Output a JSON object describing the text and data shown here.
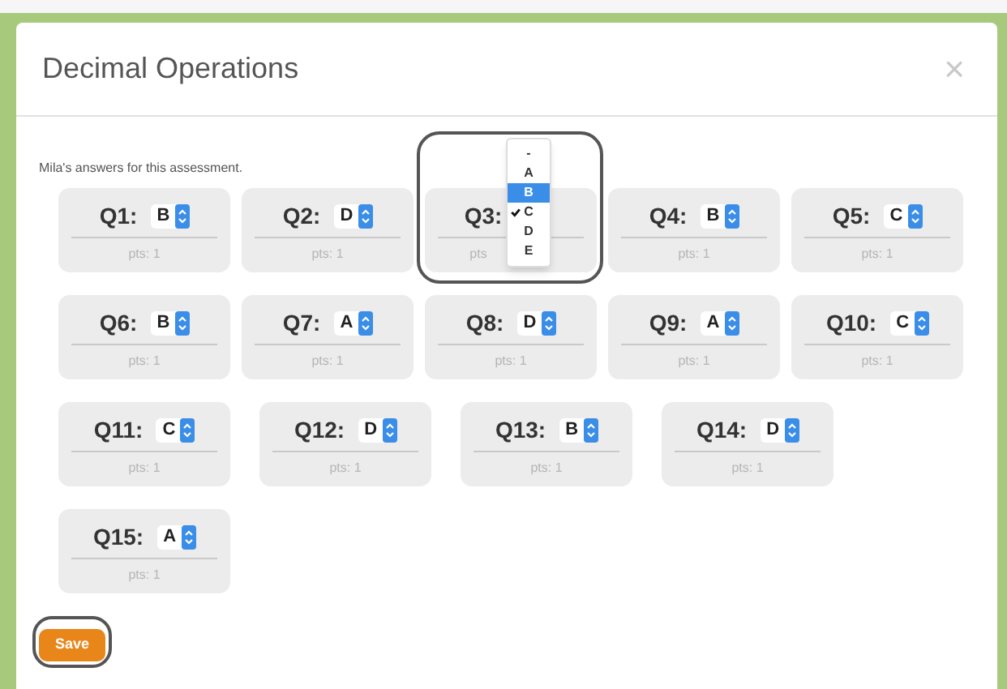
{
  "dialog": {
    "title": "Decimal Operations",
    "close": "×"
  },
  "intro": "Mila's answers for this assessment.",
  "rows": [
    [
      {
        "label": "Q1:",
        "answer": "B",
        "points": "pts: 1",
        "annotated": false
      },
      {
        "label": "Q2:",
        "answer": "D",
        "points": "pts: 1",
        "annotated": false
      },
      {
        "label": "Q3:",
        "points": "pts",
        "annotated": true,
        "menu": [
          {
            "label": "-",
            "selected": false,
            "highlighted": false
          },
          {
            "label": "A",
            "selected": false,
            "highlighted": false
          },
          {
            "label": "B",
            "selected": false,
            "highlighted": true
          },
          {
            "label": "C",
            "selected": true,
            "highlighted": false
          },
          {
            "label": "D",
            "selected": false,
            "highlighted": false
          },
          {
            "label": "E",
            "selected": false,
            "highlighted": false
          }
        ]
      },
      {
        "label": "Q4:",
        "answer": "B",
        "points": "pts: 1",
        "annotated": false
      },
      {
        "label": "Q5:",
        "answer": "C",
        "points": "pts: 1",
        "annotated": false
      }
    ],
    [
      {
        "label": "Q6:",
        "answer": "B",
        "points": "pts: 1",
        "annotated": false
      },
      {
        "label": "Q7:",
        "answer": "A",
        "points": "pts: 1",
        "annotated": false
      },
      {
        "label": "Q8:",
        "answer": "D",
        "points": "pts: 1",
        "annotated": false
      },
      {
        "label": "Q9:",
        "answer": "A",
        "points": "pts: 1",
        "annotated": false
      },
      {
        "label": "Q10:",
        "answer": "C",
        "points": "pts: 1",
        "annotated": false
      }
    ],
    [
      {
        "label": "Q11:",
        "answer": "C",
        "points": "pts: 1",
        "annotated": false
      },
      {
        "label": "Q12:",
        "answer": "D",
        "points": "pts: 1",
        "annotated": false
      },
      {
        "label": "Q13:",
        "answer": "B",
        "points": "pts: 1",
        "annotated": false
      },
      {
        "label": "Q14:",
        "answer": "D",
        "points": "pts: 1",
        "annotated": false
      }
    ],
    [
      {
        "label": "Q15:",
        "answer": "A",
        "points": "pts: 1",
        "annotated": false
      }
    ]
  ],
  "save": {
    "label": "Save",
    "annotated": true
  }
}
